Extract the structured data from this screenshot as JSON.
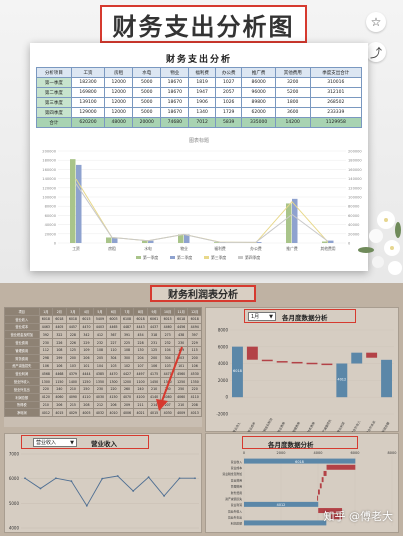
{
  "top_title": "财务支出分析图",
  "sheet": {
    "title": "财务支出分析",
    "headers": [
      "分析项目",
      "工资",
      "房租",
      "水电",
      "物业",
      "福利费",
      "办公费",
      "推广费",
      "其他费用",
      "季度支出合计"
    ],
    "rows": [
      [
        "第一季度",
        "182300",
        "12000",
        "5000",
        "18670",
        "1819",
        "1027",
        "86000",
        "3200",
        "310016"
      ],
      [
        "第二季度",
        "169800",
        "12000",
        "5000",
        "18670",
        "1947",
        "2057",
        "96000",
        "5200",
        "312101"
      ],
      [
        "第三季度",
        "139100",
        "12000",
        "5000",
        "18670",
        "1906",
        "1026",
        "89800",
        "1800",
        "268502"
      ],
      [
        "第四季度",
        "129000",
        "12000",
        "5000",
        "18670",
        "1340",
        "1729",
        "62000",
        "3600",
        "233339"
      ],
      [
        "合计",
        "620200",
        "48000",
        "20000",
        "74680",
        "7012",
        "5839",
        "335000",
        "14200",
        "1129958"
      ]
    ]
  },
  "chart_data": [
    {
      "type": "bar",
      "title": "图表标题",
      "categories": [
        "工资",
        "房租",
        "水电",
        "物业",
        "福利费",
        "办公费",
        "推广费",
        "其他费用"
      ],
      "series": [
        {
          "name": "第一季度",
          "values": [
            182300,
            12000,
            5000,
            18670,
            1819,
            1027,
            86000,
            3200
          ],
          "color": "#a9c48a"
        },
        {
          "name": "第二季度",
          "values": [
            169800,
            12000,
            5000,
            18670,
            1947,
            2057,
            96000,
            5200
          ],
          "color": "#8ea2cf"
        },
        {
          "name": "第三季度",
          "values": [
            139100,
            12000,
            5000,
            18670,
            1906,
            1026,
            89800,
            1800
          ],
          "color": "#e8d88a",
          "line": true
        },
        {
          "name": "第四季度",
          "values": [
            129000,
            12000,
            5000,
            18670,
            1340,
            1729,
            62000,
            3600
          ],
          "color": "#c9c9c9",
          "line": true
        }
      ],
      "ylim": [
        0,
        200000
      ],
      "yticks": [
        "0",
        "20000",
        "40000",
        "60000",
        "80000",
        "100000",
        "120000",
        "140000",
        "160000",
        "180000",
        "200000"
      ],
      "legend": "bottom"
    }
  ],
  "bottom": {
    "title": "财务利润表分析",
    "grid_header": [
      "项目",
      "1月",
      "2月",
      "3月",
      "4月",
      "5月",
      "6月",
      "7月",
      "8月",
      "9月",
      "10月",
      "11月",
      "12月"
    ],
    "grid_rows": [
      [
        "营业收入",
        "6018",
        "6018",
        "6018",
        "6015",
        "5409",
        "6003",
        "6108",
        "6018",
        "6061",
        "6015",
        "6018",
        "6018"
      ],
      [
        "营业成本",
        "4463",
        "4405",
        "4457",
        "4470",
        "4403",
        "4465",
        "4487",
        "4443",
        "4437",
        "4460",
        "4456",
        "4494"
      ],
      [
        "营业税金及附加",
        "392",
        "322",
        "228",
        "342",
        "412",
        "367",
        "391",
        "454",
        "318",
        "273",
        "438",
        "397"
      ],
      [
        "营业费用",
        "230",
        "226",
        "226",
        "229",
        "232",
        "227",
        "225",
        "228",
        "231",
        "232",
        "230",
        "229"
      ],
      [
        "管理费用",
        "112",
        "108",
        "125",
        "109",
        "108",
        "110",
        "108",
        "130",
        "125",
        "104",
        "109",
        "115"
      ],
      [
        "财务费用",
        "298",
        "299",
        "200",
        "206",
        "205",
        "304",
        "300",
        "204",
        "200",
        "304",
        "203",
        "200"
      ],
      [
        "资产减值损失",
        "106",
        "106",
        "103",
        "101",
        "104",
        "103",
        "102",
        "107",
        "106",
        "103",
        "101",
        "106"
      ],
      [
        "营业利润",
        "4568",
        "4468",
        "4379",
        "4444",
        "4385",
        "4470",
        "4427",
        "4497",
        "4175",
        "4471",
        "4560",
        "4530"
      ],
      [
        "营业外收入",
        "1300",
        "1150",
        "1400",
        "1250",
        "1350",
        "1300",
        "1200",
        "1100",
        "1450",
        "1300",
        "1250",
        "1350"
      ],
      [
        "营业外支出",
        "220",
        "240",
        "210",
        "250",
        "230",
        "220",
        "260",
        "240",
        "210",
        "230",
        "250",
        "220"
      ],
      [
        "利润总额",
        "4120",
        "4060",
        "4090",
        "4110",
        "4030",
        "4150",
        "4070",
        "4100",
        "4140",
        "4080",
        "4060",
        "4110"
      ],
      [
        "所得税",
        "210",
        "206",
        "215",
        "208",
        "212",
        "206",
        "209",
        "211",
        "214",
        "207",
        "210",
        "208"
      ],
      [
        "净利润",
        "4012",
        "4015",
        "4029",
        "4005",
        "4032",
        "4010",
        "4006",
        "4021",
        "4015",
        "4030",
        "4009",
        "4013"
      ]
    ],
    "panel1": {
      "select": "1月",
      "title": "各月度数据分析",
      "yticks": [
        "8000",
        "6000",
        "4000",
        "2000",
        "0",
        "-2000"
      ],
      "labels": [
        "营业收入",
        "营业成本",
        "营业税金及附加",
        "营业费用",
        "管理费用",
        "财务费用",
        "资产减值损失",
        "营业利润",
        "营业外收入",
        "营业外支出",
        "利润总额"
      ],
      "bar_labels": [
        "6018",
        "4463",
        "4000",
        "4012"
      ]
    },
    "panel2": {
      "select": "营业收入",
      "title": "营业收入",
      "yticks": [
        "7000",
        "6000",
        "5000",
        "4000"
      ],
      "values": [
        6018,
        5600,
        6018,
        5900,
        4900,
        6003,
        6108,
        5500,
        6061,
        5300,
        6018,
        6018
      ]
    },
    "panel3": {
      "title": "各月度数据分析",
      "xticks": [
        "0",
        "2000",
        "4000",
        "6000",
        "8000"
      ],
      "labels": [
        "营业收入",
        "营业成本",
        "营业税金及附加",
        "营业费用",
        "管理费用",
        "财务费用",
        "资产减值损失",
        "营业利润",
        "营业外收入",
        "营业外支出",
        "利润总额"
      ],
      "bar_labels": [
        "6018",
        "4012"
      ]
    }
  },
  "watermark": "知乎 @傅老大",
  "colors": {
    "accent": "#d63a2f",
    "waterfall_blue": "#5b87a8",
    "waterfall_red": "#b34247"
  }
}
